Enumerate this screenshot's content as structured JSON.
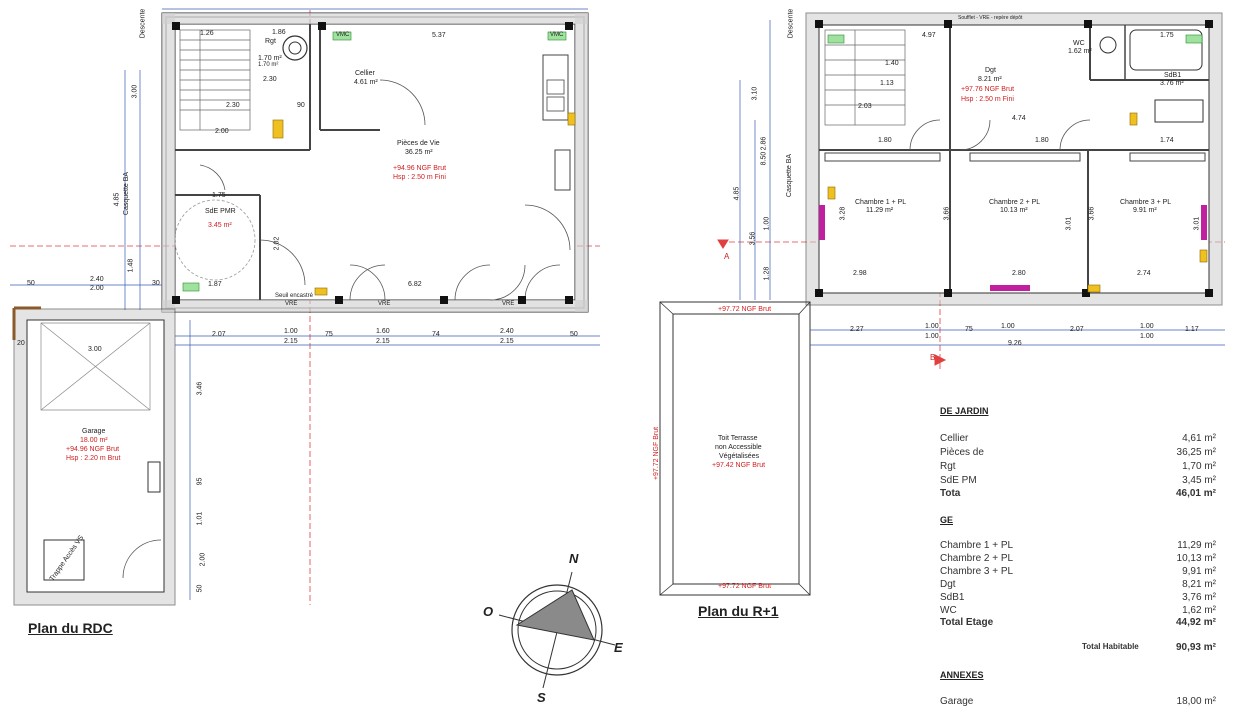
{
  "plans": {
    "rdc_title": "Plan du RDC",
    "r1_title": "Plan du R+1"
  },
  "compass": {
    "n": "N",
    "s": "S",
    "e": "E",
    "o": "O"
  },
  "rdc_rooms": {
    "cellier": {
      "name": "Cellier",
      "area": "4.61 m²"
    },
    "pieces": {
      "name": "Pièces de Vie",
      "area": "36.25 m²",
      "ngf": "+94.96 NGF Brut",
      "hsp": "Hsp : 2.50 m Fini"
    },
    "rgt": {
      "name": "Rgt",
      "area": "1.70 m²"
    },
    "sde": {
      "name": "SdE PMR",
      "area": "3.45 m²"
    },
    "garage": {
      "name": "Garage",
      "area": "18.00 m²",
      "ngf": "+94.96 NGF Brut",
      "hsp": "Hsp : 2.20 m Brut"
    },
    "trappe": "Trappe Accès VS",
    "casquette": "Casquette BA",
    "descente": "Descente",
    "seuil": "Seuil encastré",
    "vre": "VRE",
    "vmc": "VMC"
  },
  "r1_rooms": {
    "dgt": {
      "name": "Dgt",
      "area": "8.21 m²",
      "ngf": "+97.76 NGF Brut",
      "hsp": "Hsp : 2.50 m Fini"
    },
    "wc": {
      "name": "WC",
      "area": "1.62 m²"
    },
    "sdb": {
      "name": "SdB1",
      "area": "3.76 m²"
    },
    "ch1": {
      "name": "Chambre 1 + PL",
      "area": "11.29 m²"
    },
    "ch2": {
      "name": "Chambre 2 + PL",
      "area": "10.13 m²"
    },
    "ch3": {
      "name": "Chambre 3 + PL",
      "area": "9.91 m²"
    },
    "toit": {
      "l1": "Toit Terrasse",
      "l2": "non Accessible",
      "l3": "Végétalisées",
      "l4": "+97.42 NGF Brut"
    },
    "ngf_top": "+97.72 NGF Brut",
    "ngf_bottom": "+97.72 NGF Brut",
    "ngf_side": "+97.72 NGF Brut",
    "casquette": "Casquette BA",
    "descente": "Descente",
    "soufflet": "Soufflet - VRE - repère dépôt",
    "axis_a": "A",
    "axis_b": "B"
  },
  "rdc_dims": {
    "top": [
      "1.26",
      "1.86",
      "5.37"
    ],
    "bottom1": [
      "2.07",
      "1.00",
      "75",
      "1.60",
      "74",
      "2.40",
      "50"
    ],
    "bottom2": [
      "2.15",
      "2.15",
      "2.15"
    ],
    "left": [
      "3.00",
      "4.85",
      "1.48",
      "2.40",
      "2.00",
      "50",
      "30"
    ],
    "inner": [
      "2.30",
      "2.30",
      "90",
      "2.00",
      "1.75",
      "1.87",
      "6.82",
      "2.02",
      "1.70 m²"
    ],
    "garage": [
      "3.00",
      "3.46",
      "95",
      "1.01",
      "2.00",
      "50",
      "20"
    ]
  },
  "r1_dims": {
    "top": [
      "4.97",
      "1.75"
    ],
    "bottom1": [
      "2.27",
      "1.00",
      "75",
      "1.00",
      "2.07",
      "1.00",
      "1.17"
    ],
    "bottom2": [
      "1.00",
      "1.00",
      "9.26"
    ],
    "left": [
      "3.10",
      "2.86",
      "8.50",
      "4.85",
      "3.56",
      "1.00",
      "1.28"
    ],
    "inner": [
      "1.40",
      "1.13",
      "2.03",
      "4.74",
      "1.80",
      "1.80",
      "1.74",
      "2.98",
      "2.80",
      "2.74",
      "3.28",
      "3.66",
      "3.01",
      "3.66",
      "3.01"
    ]
  },
  "summary": {
    "s1": "DE JARDIN",
    "rows1": [
      {
        "label": "Cellier",
        "value": "4,61 m²"
      },
      {
        "label": "Pièces de",
        "value": "36,25 m²"
      },
      {
        "label": "Rgt",
        "value": "1,70 m²"
      },
      {
        "label": "SdE PM",
        "value": "3,45 m²"
      }
    ],
    "total1": {
      "label": "Tota",
      "value": "46,01 m²"
    },
    "s2": "GE",
    "rows2": [
      {
        "label": "Chambre 1 + PL",
        "value": "11,29 m²"
      },
      {
        "label": "Chambre 2 + PL",
        "value": "10,13 m²"
      },
      {
        "label": "Chambre 3 + PL",
        "value": "9,91 m²"
      },
      {
        "label": "Dgt",
        "value": "8,21 m²"
      },
      {
        "label": "SdB1",
        "value": "3,76 m²"
      },
      {
        "label": "WC",
        "value": "1,62 m²"
      }
    ],
    "total2": {
      "label": "Total Etage",
      "value": "44,92 m²"
    },
    "total_hab": {
      "label": "Total Habitable",
      "value": "90,93 m²"
    },
    "s3": "ANNEXES",
    "rows3": [
      {
        "label": "Garage",
        "value": "18,00 m²"
      }
    ]
  }
}
